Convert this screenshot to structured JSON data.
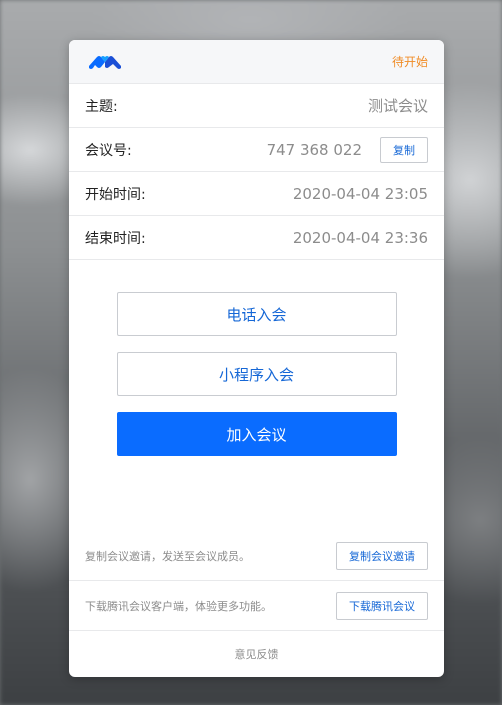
{
  "header": {
    "status": "待开始"
  },
  "meeting": {
    "rows": [
      {
        "label": "主题:",
        "value": "测试会议"
      },
      {
        "label": "会议号:",
        "value": "747 368 022"
      },
      {
        "label": "开始时间:",
        "value": "2020-04-04 23:05"
      },
      {
        "label": "结束时间:",
        "value": "2020-04-04 23:36"
      }
    ],
    "copy_label": "复制"
  },
  "actions": {
    "phone_join": "电话入会",
    "miniprogram_join": "小程序入会",
    "join": "加入会议"
  },
  "footer": {
    "invite_text": "复制会议邀请，发送至会议成员。",
    "invite_button": "复制会议邀请",
    "download_text": "下载腾讯会议客户端，体验更多功能。",
    "download_button": "下载腾讯会议",
    "feedback": "意见反馈"
  },
  "colors": {
    "accent": "#0a6cff",
    "status": "#f08c26",
    "link": "#1567d6"
  }
}
